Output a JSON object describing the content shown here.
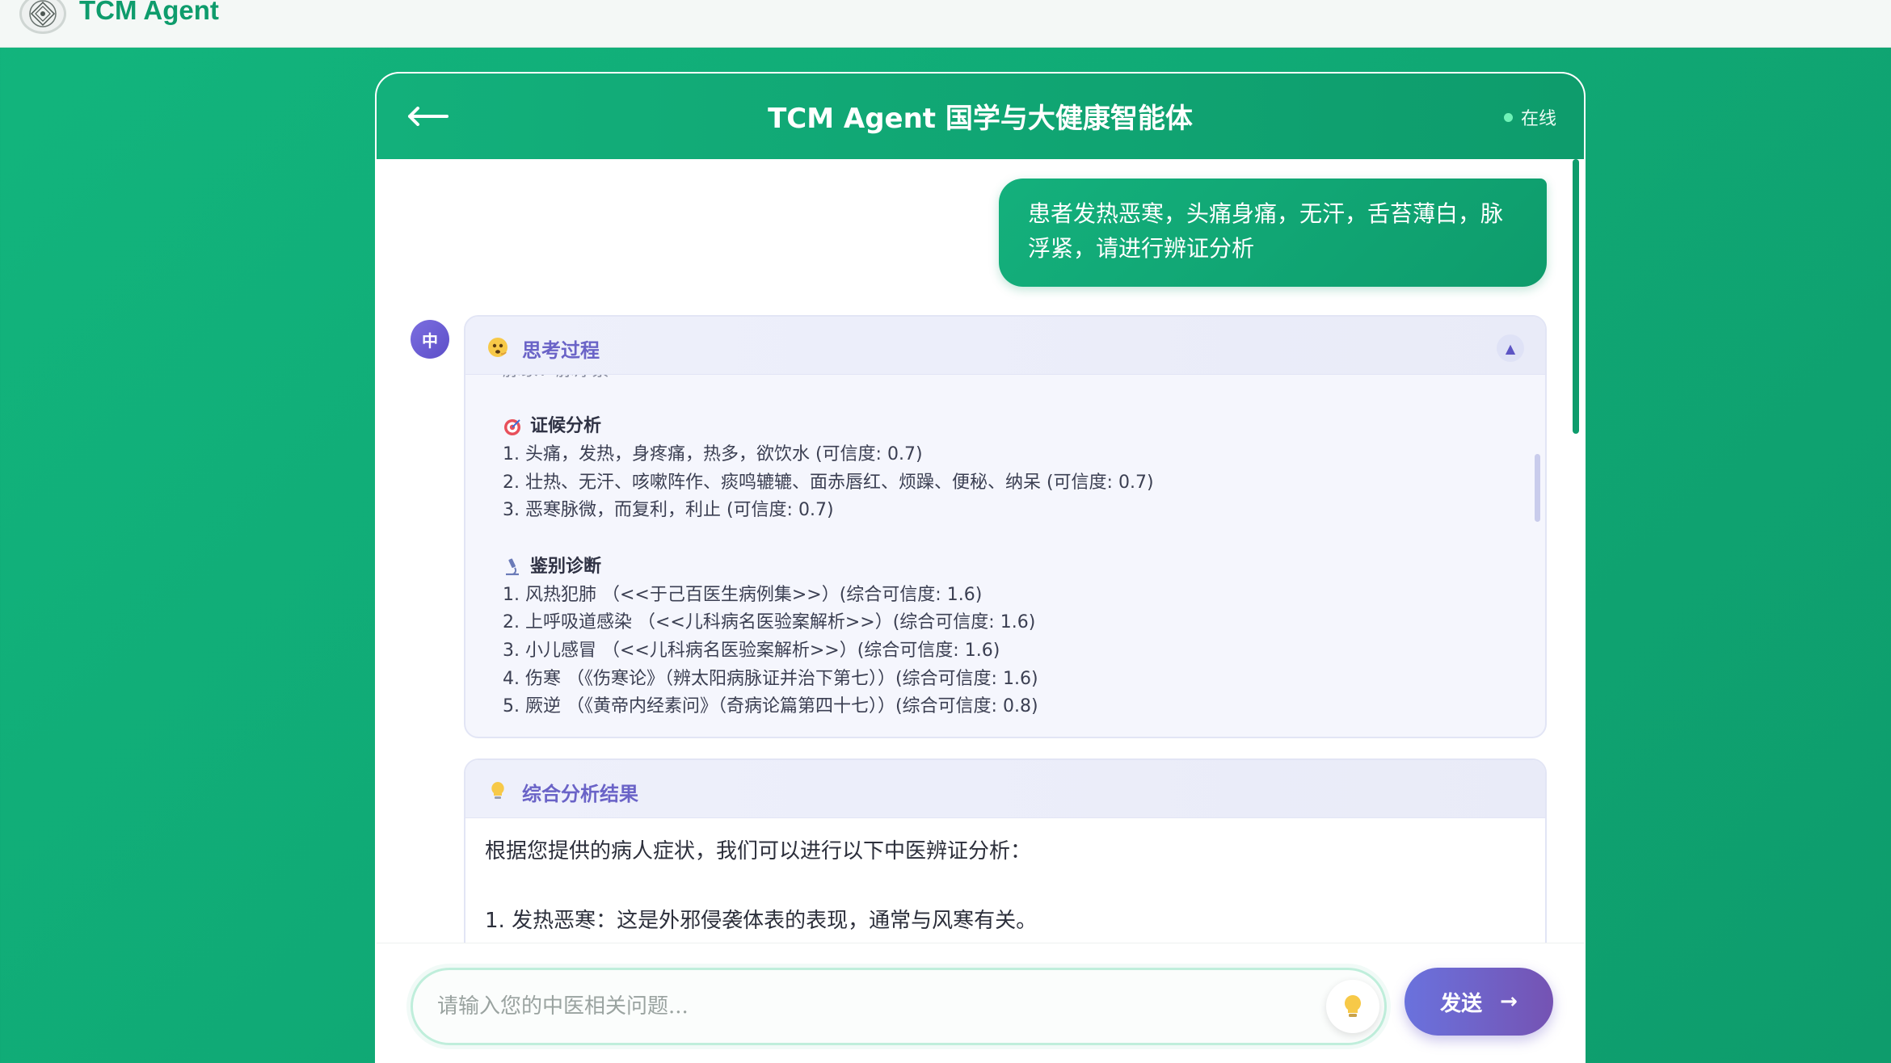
{
  "app": {
    "brand_name": "TCM Agent",
    "icons": {
      "logo": "leaf-emblem-icon"
    }
  },
  "chat": {
    "title": "TCM Agent 国学与大健康智能体",
    "status_label": "在线",
    "colors": {
      "accent": "#0e9c6c",
      "accent_light": "#14b07c",
      "bot": "#5d4fc8",
      "online": "#6ff2b7"
    }
  },
  "user_message": {
    "text": "患者发热恶寒，头痛身痛，无汗，舌苔薄白，脉浮紧，请进行辨证分析"
  },
  "bot": {
    "avatar_label": "中"
  },
  "thinking": {
    "title": "思考过程",
    "cut_line": "脉象：脉浮紧",
    "syndrome": {
      "title": "证候分析",
      "items": [
        "1. 头痛，发热，身疼痛，热多，欲饮水 (可信度: 0.7)",
        "2. 壮热、无汗、咳嗽阵作、痰鸣辘辘、面赤唇红、烦躁、便秘、纳呆 (可信度: 0.7)",
        "3. 恶寒脉微，而复利，利止 (可信度: 0.7)"
      ]
    },
    "differential": {
      "title": "鉴别诊断",
      "items": [
        "1. 风热犯肺 （<<于己百医生病例集>>）(综合可信度: 1.6)",
        "2. 上呼吸道感染 （<<儿科病名医验案解析>>）(综合可信度: 1.6)",
        "3. 小儿感冒 （<<儿科病名医验案解析>>）(综合可信度: 1.6)",
        "4. 伤寒 （《伤寒论》（辨太阳病脉证并治下第七））(综合可信度: 1.6)",
        "5. 厥逆 （《黄帝内经素问》（奇病论篇第四十七））(综合可信度: 0.8)"
      ]
    }
  },
  "result": {
    "title": "综合分析结果",
    "lines": [
      "根据您提供的病人症状，我们可以进行以下中医辨证分析：",
      "1. 发热恶寒：这是外邪侵袭体表的表现，通常与风寒有关。"
    ]
  },
  "composer": {
    "placeholder": "请输入您的中医相关问题...",
    "send_label": "发送"
  }
}
